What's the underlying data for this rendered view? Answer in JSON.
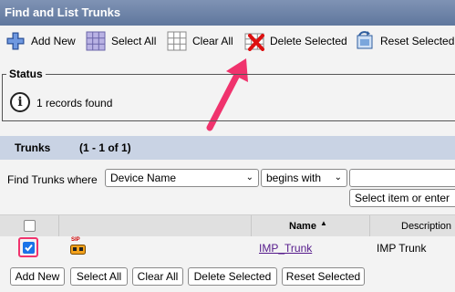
{
  "page_title": "Find and List Trunks",
  "toolbar": {
    "add_new": "Add New",
    "select_all": "Select All",
    "clear_all": "Clear All",
    "delete_selected": "Delete Selected",
    "reset_selected": "Reset Selected"
  },
  "status": {
    "legend": "Status",
    "message": "1 records found"
  },
  "trunks": {
    "title": "Trunks",
    "range": "(1 - 1 of 1)"
  },
  "find": {
    "label": "Find Trunks where",
    "field_value": "Device Name",
    "operator_value": "begins with",
    "search_value": "",
    "select_item_button": "Select item or enter"
  },
  "table": {
    "columns": [
      "Name",
      "Description"
    ],
    "sort_indicator": "▲",
    "rows": [
      {
        "icon_label": "SIP",
        "name": "IMP_Trunk",
        "description": "IMP Trunk",
        "checked": true
      }
    ]
  },
  "bottom_buttons": {
    "add_new": "Add New",
    "select_all": "Select All",
    "clear_all": "Clear All",
    "delete_selected": "Delete Selected",
    "reset_selected": "Reset Selected"
  },
  "colors": {
    "title_bar": "#6f85a9",
    "trunks_bar": "#c9d3e4",
    "annotation_pink": "#f0336d",
    "checkbox_blue": "#1a73e8",
    "link_purple": "#551a8b"
  },
  "icons": [
    "add-icon",
    "select-all-icon",
    "clear-all-icon",
    "delete-selected-icon",
    "reset-selected-icon",
    "info-icon",
    "sip-trunk-icon"
  ]
}
